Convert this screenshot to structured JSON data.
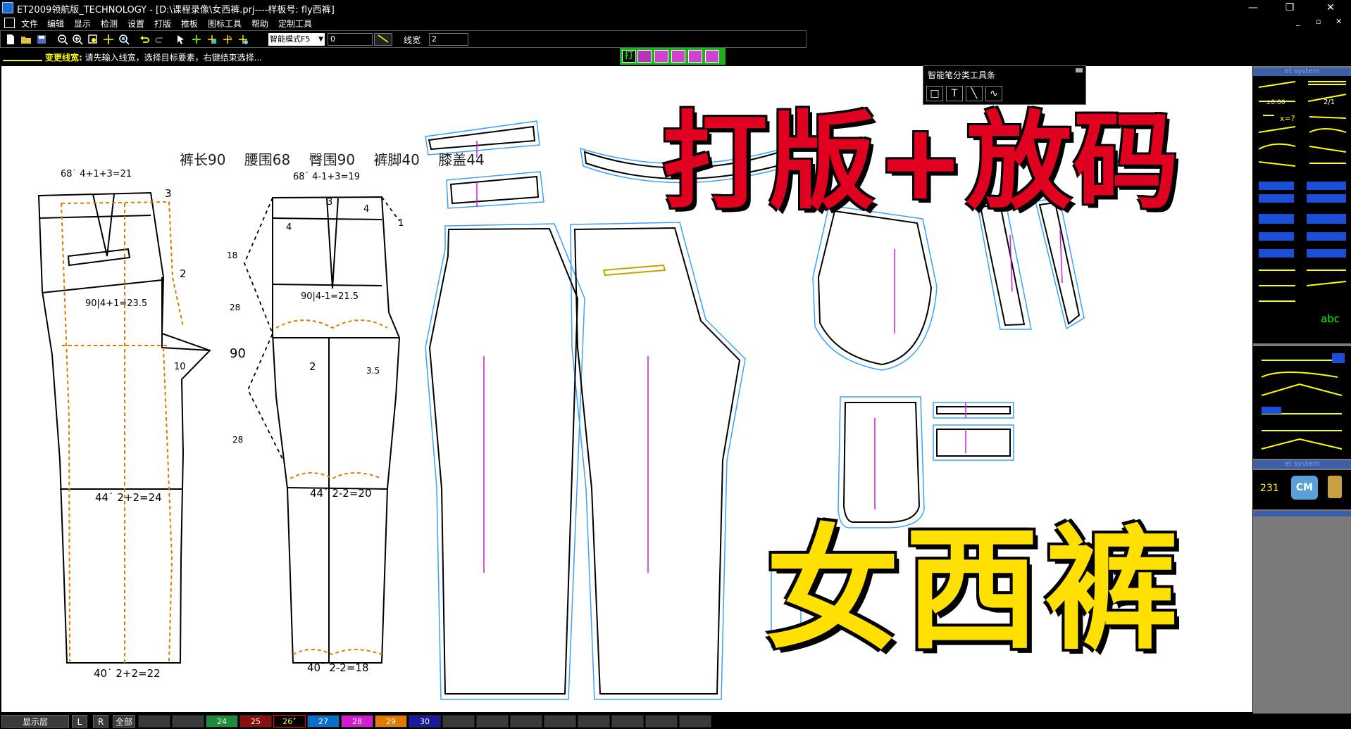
{
  "window": {
    "title": "ET2009领航版_TECHNOLOGY - [D:\\课程录像\\女西裤.prj----样板号: fly西裤]",
    "minimize": "—",
    "maximize": "❐",
    "close": "✕"
  },
  "menu": {
    "items": [
      "文件",
      "编辑",
      "显示",
      "检测",
      "设置",
      "打版",
      "推板",
      "图标工具",
      "帮助",
      "定制工具"
    ]
  },
  "toolbar": {
    "mode": "智能模式F5",
    "value_input": "0",
    "linewidth_label": "线宽",
    "linewidth_value": "2"
  },
  "hint": {
    "action": "变更线宽:",
    "message": "请先输入线宽，选择目标要素，右键结束选择..."
  },
  "canvas": {
    "measurements": [
      "裤长90",
      "腰围68",
      "臀围90",
      "裤脚40",
      "膝盖44"
    ],
    "front_labels": {
      "waist_formula": "68˙ 4+1+3=21",
      "hip_formula": "90|4+1=23.5",
      "knee_formula": "44˙ 2+2=24",
      "hem_formula": "40˙ 2+2=22",
      "dart_3": "3",
      "dart_2": "2",
      "crotch_10": "10",
      "label_90": "90"
    },
    "back_labels": {
      "waist_formula": "68˙ 4-1+3=19",
      "hip_formula": "90|4-1=21.5",
      "knee_formula": "44˙ 2-2=20",
      "hem_formula": "40˙ 2-2=18",
      "n3": "3",
      "n4a": "4",
      "n4b": "4",
      "n1": "1",
      "n18": "18",
      "n28a": "28",
      "n28b": "28",
      "n2": "2",
      "n35": "3.5"
    }
  },
  "overlay": {
    "headline": "打版+放码",
    "subject": "女西裤"
  },
  "pen_toolbar": {
    "title": "智能笔分类工具条",
    "buttons": [
      "□",
      "T",
      "╲",
      "∿"
    ]
  },
  "right_panel": {
    "header1": "et system",
    "header2": "et system",
    "header3": "et system",
    "formula_x": "x=?",
    "formula_ratio": "2/1",
    "formula_zero": "±0.00",
    "abc": "abc",
    "code_231": "231",
    "cm": "CM"
  },
  "layerbar": {
    "label": "显示层",
    "btn_l": "L",
    "btn_r": "R",
    "btn_all": "全部",
    "layers": [
      {
        "num": "",
        "color": "#3a3a3a"
      },
      {
        "num": "",
        "color": "#3a3a3a"
      },
      {
        "num": "24",
        "color": "#1e8a3a"
      },
      {
        "num": "25",
        "color": "#8a1010"
      },
      {
        "num": "26˚",
        "color": "#000000"
      },
      {
        "num": "27",
        "color": "#0a6fc9"
      },
      {
        "num": "28",
        "color": "#d21cd2"
      },
      {
        "num": "29",
        "color": "#e07a00"
      },
      {
        "num": "30",
        "color": "#1a1a9a"
      },
      {
        "num": "",
        "color": "#3a3a3a"
      },
      {
        "num": "",
        "color": "#3a3a3a"
      },
      {
        "num": "",
        "color": "#3a3a3a"
      },
      {
        "num": "",
        "color": "#3a3a3a"
      },
      {
        "num": "",
        "color": "#3a3a3a"
      },
      {
        "num": "",
        "color": "#3a3a3a"
      },
      {
        "num": "",
        "color": "#3a3a3a"
      },
      {
        "num": "",
        "color": "#3a3a3a"
      }
    ]
  }
}
